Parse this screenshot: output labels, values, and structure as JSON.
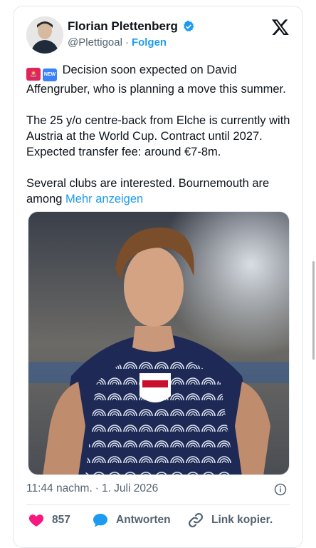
{
  "author": {
    "name": "Florian Plettenberg",
    "handle": "@Plettigoal",
    "separator": "·",
    "follow_label": "Folgen"
  },
  "tweet": {
    "line1": "Decision soon expected on David Affengruber, who is planning a move this summer.",
    "line2": "The 25 y/o centre-back from Elche is currently with Austria at the World Cup. Contract until 2027. Expected transfer fee: around €7-8m.",
    "line3": "Several clubs are interested. Bournemouth are among",
    "more_label": "Mehr anzeigen",
    "emoji1": "siren-emoji",
    "emoji2": "new-emoji",
    "new_badge": "NEW"
  },
  "meta": {
    "time": "11:44 nachm.",
    "separator": "·",
    "date": "1. Juli 2026"
  },
  "actions": {
    "likes": "857",
    "reply_label": "Antworten",
    "copy_label": "Link kopier."
  },
  "colors": {
    "accent": "#1d9bf0",
    "like": "#f91880",
    "text": "#0f1419",
    "muted": "#536471"
  }
}
